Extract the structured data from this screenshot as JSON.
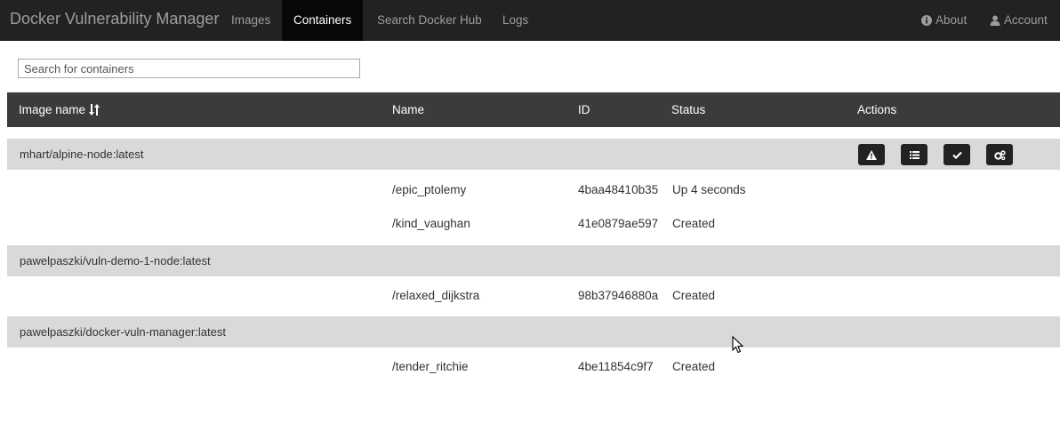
{
  "navbar": {
    "brand": "Docker Vulnerability Manager",
    "links": [
      {
        "label": "Images",
        "active": false
      },
      {
        "label": "Containers",
        "active": true
      },
      {
        "label": "Search Docker Hub",
        "active": false
      },
      {
        "label": "Logs",
        "active": false
      }
    ],
    "right_links": [
      {
        "label": "About",
        "icon": "info-circle-icon"
      },
      {
        "label": "Account",
        "icon": "user-icon"
      }
    ]
  },
  "search": {
    "placeholder": "Search for containers",
    "value": ""
  },
  "table": {
    "headers": {
      "image_name": "Image name",
      "name": "Name",
      "id": "ID",
      "status": "Status",
      "actions": "Actions"
    },
    "sort_icon": "sort-icon",
    "action_icons": [
      "warning-icon",
      "list-icon",
      "check-icon",
      "cogs-icon"
    ],
    "groups": [
      {
        "image": "mhart/alpine-node:latest",
        "containers": [
          {
            "name": "/epic_ptolemy",
            "id": "4baa48410b35",
            "status": "Up 4 seconds"
          },
          {
            "name": "/kind_vaughan",
            "id": "41e0879ae597",
            "status": "Created"
          }
        ]
      },
      {
        "image": "pawelpaszki/vuln-demo-1-node:latest",
        "containers": [
          {
            "name": "/relaxed_dijkstra",
            "id": "98b37946880a",
            "status": "Created"
          }
        ]
      },
      {
        "image": "pawelpaszki/docker-vuln-manager:latest",
        "containers": [
          {
            "name": "/tender_ritchie",
            "id": "4be11854c9f7",
            "status": "Created"
          }
        ]
      }
    ]
  },
  "colors": {
    "navbar_bg": "#222222",
    "navbar_active_bg": "#080808",
    "table_header_bg": "#3b3b3b",
    "group_row_bg": "#d9d9d9",
    "button_bg": "#222222"
  }
}
